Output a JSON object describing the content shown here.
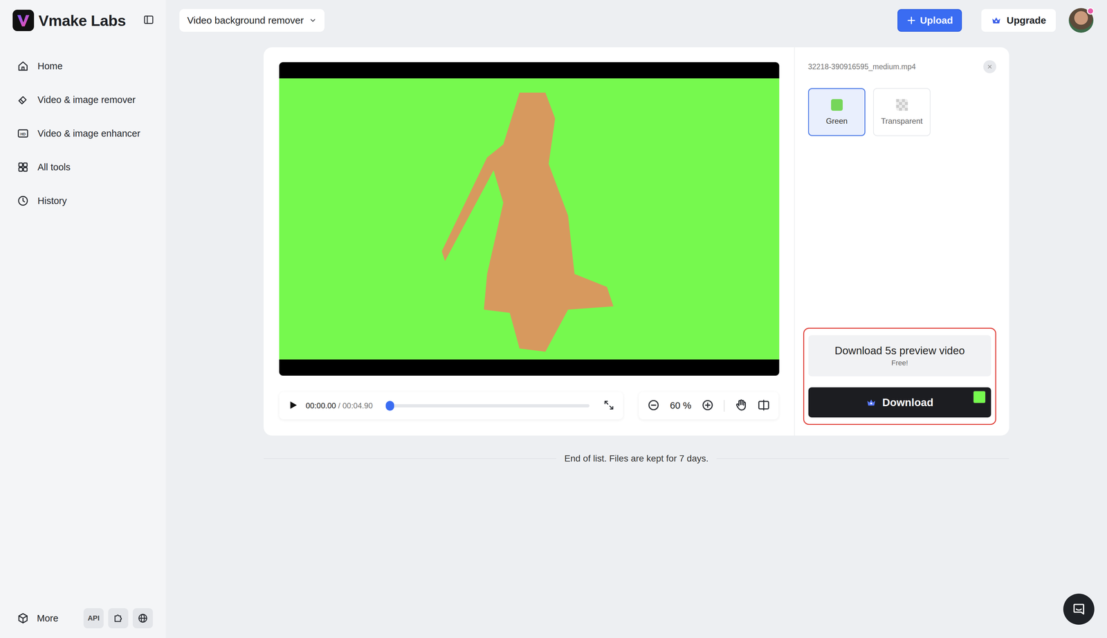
{
  "app": {
    "name": "Vmake Labs"
  },
  "sidebar": {
    "items": [
      {
        "label": "Home"
      },
      {
        "label": "Video & image remover"
      },
      {
        "label": "Video & image enhancer"
      },
      {
        "label": "All tools"
      },
      {
        "label": "History"
      }
    ],
    "more": "More",
    "api": "API"
  },
  "toolbar": {
    "tool_select": "Video background remover",
    "upload": "Upload",
    "upgrade": "Upgrade"
  },
  "player": {
    "current": "00:00.00",
    "duration": "/ 00:04.90",
    "level": 0,
    "zoom": "60 %"
  },
  "file": {
    "name": "32218-390916595_medium.mp4"
  },
  "backgrounds": [
    {
      "label": "Green",
      "selected": true,
      "kind": "color"
    },
    {
      "label": "Transparent",
      "selected": false,
      "kind": "checker"
    }
  ],
  "download": {
    "preview": "Download 5s preview video",
    "preview_note": "Free!",
    "button": "Download",
    "color": "#76f94e"
  },
  "footer_note": "End of list. Files are kept for 7 days."
}
